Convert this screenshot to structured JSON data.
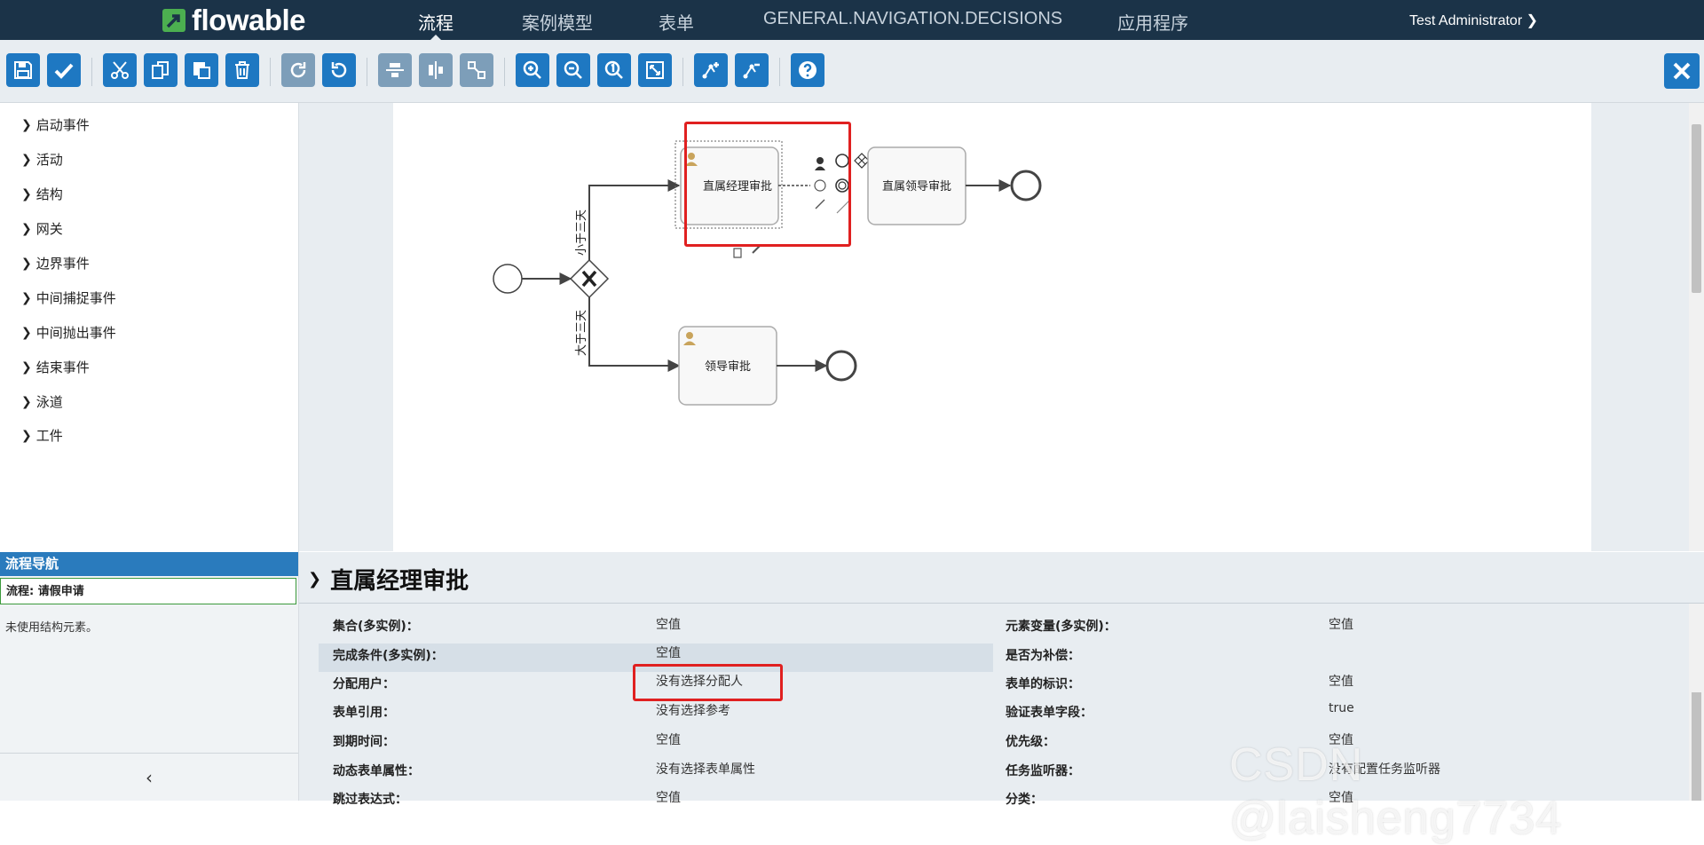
{
  "header": {
    "logo_text": "flowable",
    "nav": [
      "流程",
      "案例模型",
      "表单",
      "GENERAL.NAVIGATION.DECISIONS",
      "应用程序"
    ],
    "user": "Test Administrator ❯",
    "colors": {
      "bar": "#1b3348",
      "accent": "#1e78c2"
    }
  },
  "toolbar": {
    "buttons": [
      "save-icon",
      "validate-icon",
      "cut-icon",
      "copy-icon",
      "paste-icon",
      "delete-icon",
      "redo-icon",
      "undo-icon",
      "align-vertical-icon",
      "align-horizontal-icon",
      "same-size-icon",
      "zoom-in-icon",
      "zoom-out-icon",
      "zoom-actual-icon",
      "zoom-fit-icon",
      "bendpoint-add-icon",
      "bendpoint-remove-icon",
      "help-icon"
    ],
    "close": "close-icon"
  },
  "palette": {
    "items": [
      "启动事件",
      "活动",
      "结构",
      "网关",
      "边界事件",
      "中间捕捉事件",
      "中间抛出事件",
      "结束事件",
      "泳道",
      "工件"
    ]
  },
  "diagram": {
    "task_manager": "直属经理审批",
    "task_leader_top": "直属领导审批",
    "task_leader": "领导审批",
    "flow_less": "小于三天",
    "flow_more": "大于三天"
  },
  "navigator": {
    "title": "流程导航",
    "process": "流程: 请假申请",
    "message": "未使用结构元素。",
    "collapse": "‹"
  },
  "properties": {
    "title": "直属经理审批",
    "left": [
      {
        "label": "集合(多实例)：",
        "value": "空值"
      },
      {
        "label": "完成条件(多实例)：",
        "value": "空值"
      },
      {
        "label": "分配用户：",
        "value": "没有选择分配人"
      },
      {
        "label": "表单引用：",
        "value": "没有选择参考"
      },
      {
        "label": "到期时间：",
        "value": "空值"
      },
      {
        "label": "动态表单属性：",
        "value": "没有选择表单属性"
      },
      {
        "label": "跳过表达式：",
        "value": "空值"
      }
    ],
    "right": [
      {
        "label": "元素变量(多实例)：",
        "value": "空值"
      },
      {
        "label": "是否为补偿：",
        "value": ""
      },
      {
        "label": "表单的标识：",
        "value": "空值"
      },
      {
        "label": "验证表单字段：",
        "value": "true"
      },
      {
        "label": "优先级：",
        "value": "空值"
      },
      {
        "label": "任务监听器：",
        "value": "没有配置任务监听器"
      },
      {
        "label": "分类：",
        "value": "空值"
      }
    ]
  },
  "watermark": "CSDN @laisheng7734"
}
